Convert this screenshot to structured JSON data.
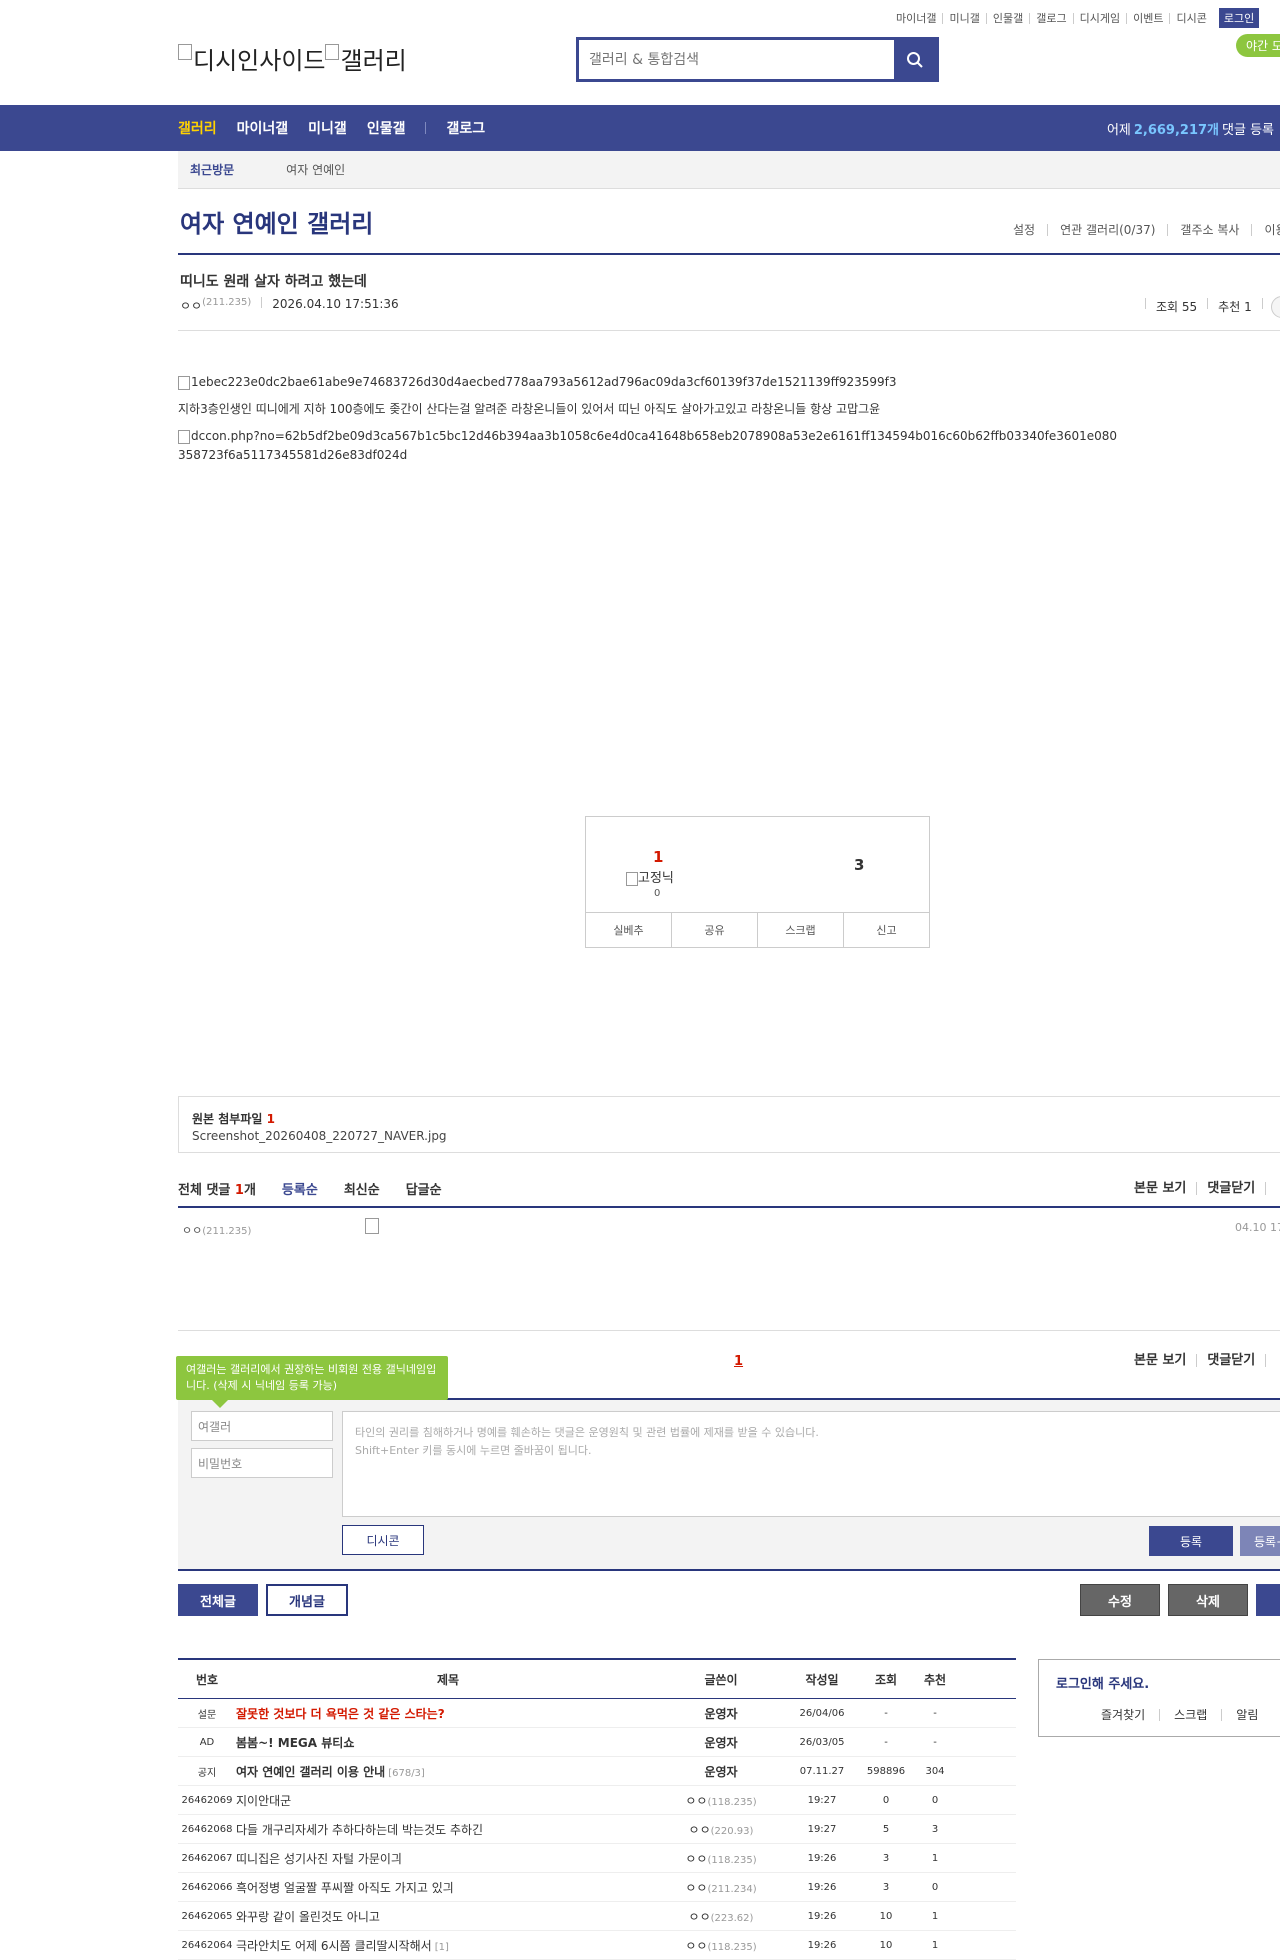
{
  "util": {
    "links": [
      "마이너갤",
      "미니갤",
      "인물갤",
      "갤로그",
      "디시게임",
      "이벤트",
      "디시콘"
    ],
    "login": "로그인",
    "night": "야간 모드"
  },
  "logo": {
    "part1": "디시인사이드",
    "part2": "갤러리"
  },
  "search": {
    "placeholder": "갤러리 & 통합검색"
  },
  "gnb": {
    "items": [
      "갤러리",
      "마이너갤",
      "미니갤",
      "인물갤",
      "갤로그"
    ],
    "stat_prefix": "어제",
    "stat_value": "2,669,217개",
    "stat_suffix": "댓글 등록"
  },
  "visit": {
    "label": "최근방문",
    "item": "여자 연예인"
  },
  "gallery": {
    "title": "여자 연예인 갤러리",
    "options": [
      "설정",
      "연관 갤러리(0/37)",
      "갤주소 복사",
      "이용"
    ]
  },
  "post": {
    "title": "띠니도 원래 살자 하려고 했는데",
    "writer": "ㅇㅇ",
    "ip": "(211.235)",
    "date": "2026.04.10 17:51:36",
    "views": "조회 55",
    "recommends": "추천 1",
    "img1": "1ebec223e0dc2bae61abe9e74683726d30d4aecbed778aa793a5612ad796ac09da3cf60139f37de1521139ff923599f3",
    "text": "지하3층인생인 띠니에게 지하 100층에도 좆간이 산다는걸 알려준 라창온니들이 있어서 띠닌 아직도 살아가고있고 라창온니들 항상 고맙그윤",
    "img2": "dccon.php?no=62b5df2be09d3ca567b1c5bc12d46b394aa3b1058c6e4d0ca41648b658eb2078908a53e2e6161ff134594b016c60b62ffb03340fe3601e080",
    "img2_cont": "358723f6a5117345581d26e83df024d"
  },
  "recommend": {
    "up": "1",
    "fixed": "고정닉",
    "fixed_count": "0",
    "down": "3",
    "buttons": [
      "실베추",
      "공유",
      "스크랩",
      "신고"
    ]
  },
  "attach": {
    "label": "원본 첨부파일",
    "count": "1",
    "file": "Screenshot_20260408_220727_NAVER.jpg"
  },
  "comments": {
    "total_label": "전체 댓글",
    "total_count": "1",
    "total_unit": "개",
    "sort": [
      "등록순",
      "최신순",
      "답글순"
    ],
    "right": [
      "본문 보기",
      "댓글닫기"
    ],
    "writer": "ㅇㅇ",
    "ip": "(211.235)",
    "date": "04.10 17",
    "page": "1"
  },
  "write": {
    "tip": "여갤러는 갤러리에서 권장하는 비회원 전용 갤닉네임입니다. (삭제 시 닉네임 등록 가능)",
    "nick": "여갤러",
    "pw_placeholder": "비밀번호",
    "notice1": "타인의 권리를 침해하거나 명예를 훼손하는 댓글은 운영원칙 및 관련 법률에 제재를 받을 수 있습니다.",
    "notice2": "Shift+Enter 키를 동시에 누르면 줄바꿈이 됩니다.",
    "dccon": "디시콘",
    "submit": "등록",
    "submit2": "등록+"
  },
  "bottom": {
    "all": "전체글",
    "concept": "개념글",
    "edit": "수정",
    "delete": "삭제"
  },
  "list": {
    "headers": [
      "번호",
      "제목",
      "글쓴이",
      "작성일",
      "조회",
      "추천"
    ],
    "rows": [
      {
        "no": "설문",
        "title": "잘못한 것보다 더 욕먹은 것 같은 스타는?",
        "rc": "",
        "writer": "운영자",
        "ip": "",
        "date": "26/04/06",
        "views": "-",
        "rec": "-",
        "style": "red"
      },
      {
        "no": "AD",
        "title": "봄봄~! MEGA 뷰티쇼",
        "rc": "",
        "writer": "운영자",
        "ip": "",
        "date": "26/03/05",
        "views": "-",
        "rec": "-",
        "style": "bold"
      },
      {
        "no": "공지",
        "title": "여자 연예인 갤러리 이용 안내",
        "rc": "[678/3]",
        "writer": "운영자",
        "ip": "",
        "date": "07.11.27",
        "views": "598896",
        "rec": "304",
        "style": "bold"
      },
      {
        "no": "26462069",
        "title": "지이안대군",
        "rc": "",
        "writer": "ㅇㅇ",
        "ip": "(118.235)",
        "date": "19:27",
        "views": "0",
        "rec": "0",
        "style": ""
      },
      {
        "no": "26462068",
        "title": "다들 개구리자세가 추하다하는데 박는것도 추하긴",
        "rc": "",
        "writer": "ㅇㅇ",
        "ip": "(220.93)",
        "date": "19:27",
        "views": "5",
        "rec": "3",
        "style": ""
      },
      {
        "no": "26462067",
        "title": "띠니집은 성기사진 자털 가문이긔",
        "rc": "",
        "writer": "ㅇㅇ",
        "ip": "(118.235)",
        "date": "19:26",
        "views": "3",
        "rec": "1",
        "style": ""
      },
      {
        "no": "26462066",
        "title": "흑어정병 얼굴짤 푸씨짤 아직도 가지고 있긔",
        "rc": "",
        "writer": "ㅇㅇ",
        "ip": "(211.234)",
        "date": "19:26",
        "views": "3",
        "rec": "0",
        "style": ""
      },
      {
        "no": "26462065",
        "title": "와꾸랑 같이 올린것도 아니고",
        "rc": "",
        "writer": "ㅇㅇ",
        "ip": "(223.62)",
        "date": "19:26",
        "views": "10",
        "rec": "1",
        "style": ""
      },
      {
        "no": "26462064",
        "title": "극라안치도 어제 6시쯤 클리딸시작해서",
        "rc": "[1]",
        "writer": "ㅇㅇ",
        "ip": "(118.235)",
        "date": "19:26",
        "views": "10",
        "rec": "1",
        "style": ""
      }
    ]
  },
  "loginbox": {
    "title": "로그인해 주세요.",
    "links": [
      "즐겨찾기",
      "스크랩",
      "알림"
    ]
  },
  "colors": {
    "brand": "#3b4890",
    "accent": "#d31900",
    "highlight": "#ffd200",
    "tip": "#8dc63f"
  }
}
